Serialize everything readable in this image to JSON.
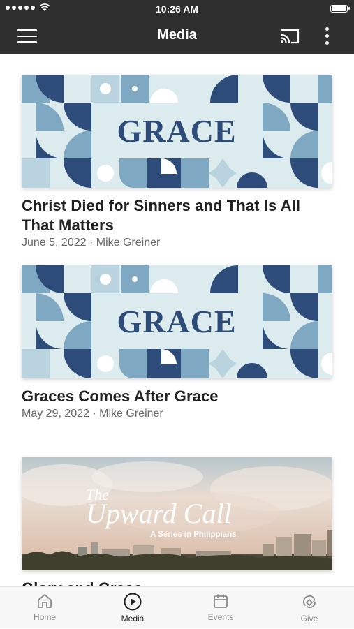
{
  "status_bar": {
    "time": "10:26 AM"
  },
  "app_bar": {
    "title": "Media"
  },
  "media_items": [
    {
      "title": "Christ Died for Sinners and That Is All That Matters",
      "meta": "June 5, 2022 · Mike Greiner",
      "image_text": "GRACE"
    },
    {
      "title": "Graces Comes After Grace",
      "meta": "May 29, 2022 · Mike Greiner",
      "image_text": "GRACE"
    },
    {
      "title": "Glory and Grace",
      "image_text": {
        "line1": "The",
        "line2": "Upward Call",
        "subtitle": "A Series in Philippians"
      }
    }
  ],
  "tabs": [
    {
      "label": "Home",
      "icon": "home-icon"
    },
    {
      "label": "Media",
      "icon": "play-circle-icon",
      "active": true
    },
    {
      "label": "Events",
      "icon": "calendar-icon"
    },
    {
      "label": "Give",
      "icon": "give-icon"
    }
  ],
  "colors": {
    "bar": "#2f2f2f",
    "grace_dark": "#2e4c79",
    "grace_mid": "#7fa9c2",
    "grace_light": "#dcebee"
  }
}
